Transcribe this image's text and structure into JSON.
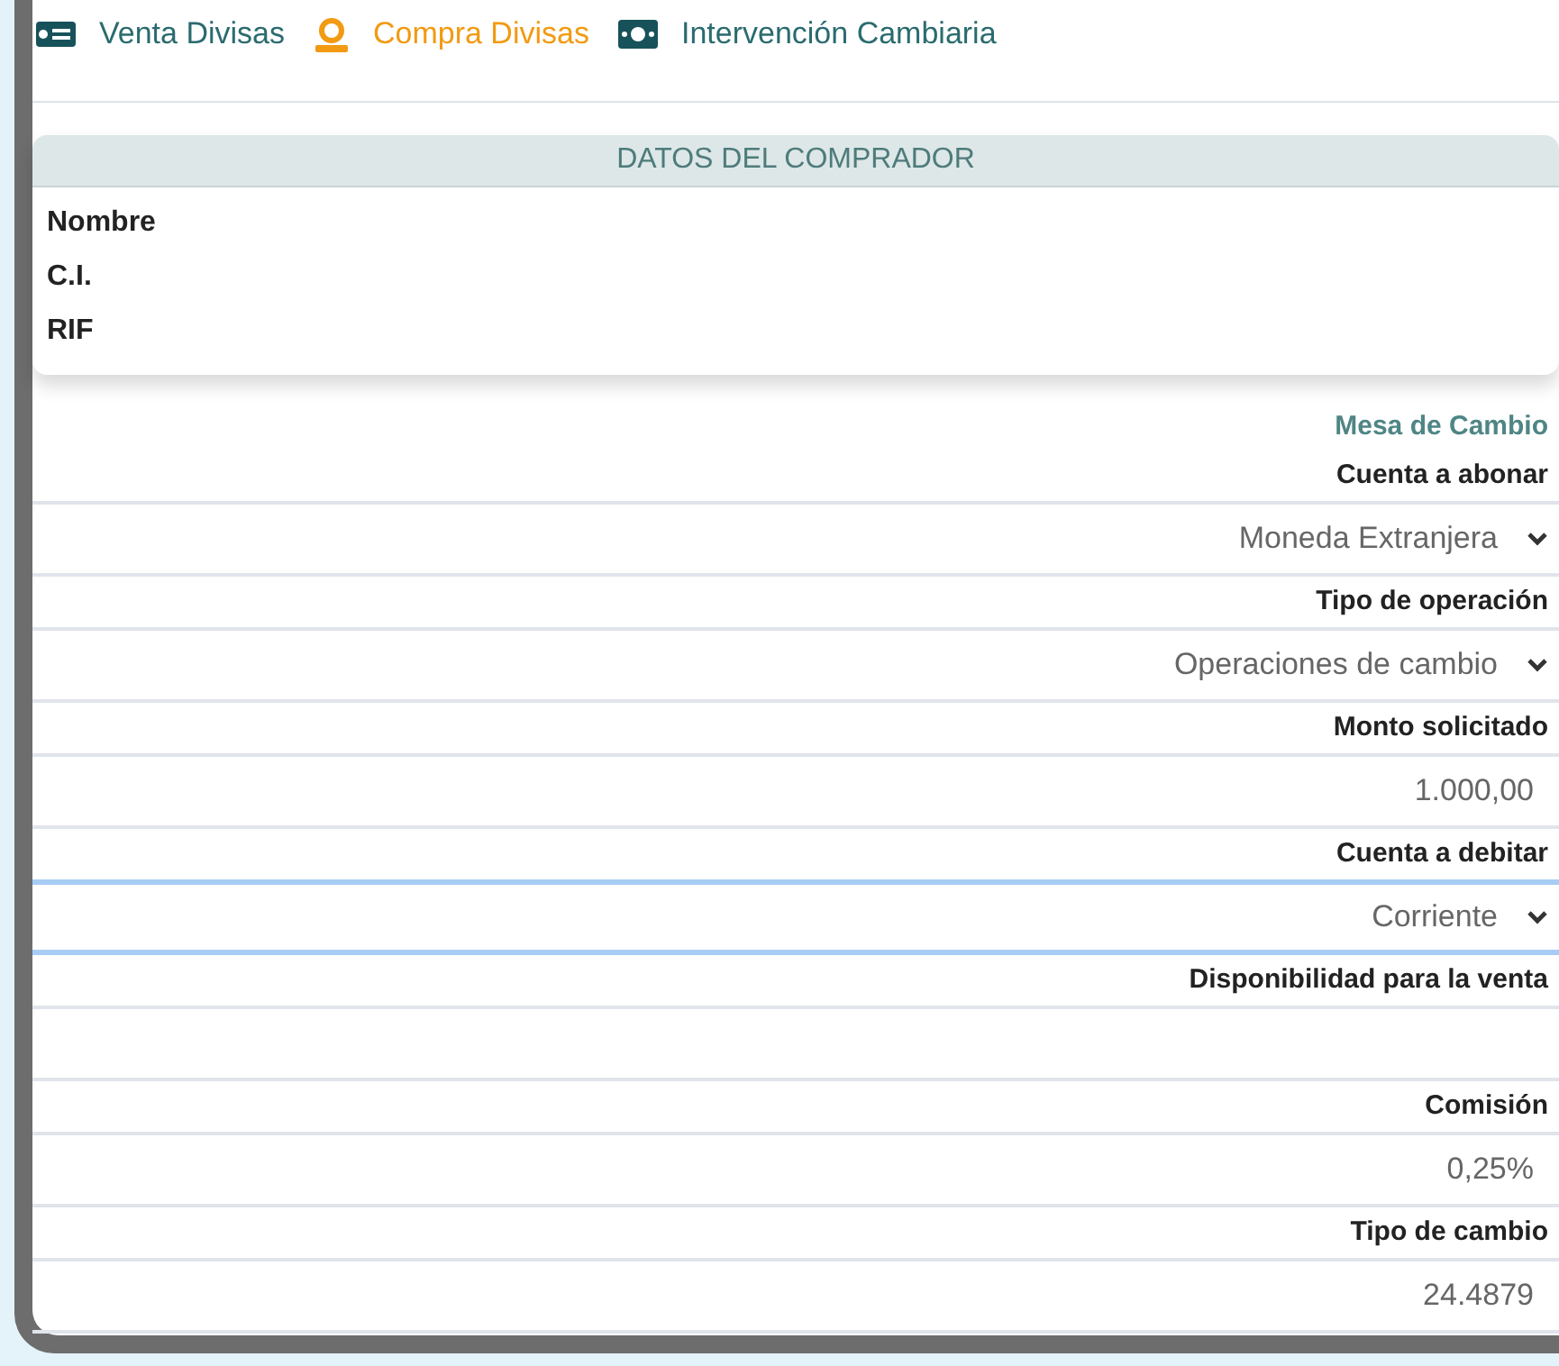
{
  "tabs": [
    {
      "label": "Venta Divisas",
      "selected": false
    },
    {
      "label": "Compra Divisas",
      "selected": true
    },
    {
      "label": "Intervención Cambiaria",
      "selected": false
    }
  ],
  "buyer_card": {
    "title": "DATOS DEL COMPRADOR",
    "fields": [
      "Nombre",
      "C.I.",
      "RIF"
    ]
  },
  "section_title": "Mesa de Cambio",
  "fields": [
    {
      "label": "Cuenta a abonar",
      "kind": "select",
      "value": "Moneda Extranjera",
      "focused": false
    },
    {
      "label": "Tipo de operación",
      "kind": "select",
      "value": "Operaciones de cambio",
      "focused": false
    },
    {
      "label": "Monto solicitado",
      "kind": "text",
      "value": "1.000,00",
      "focused": false
    },
    {
      "label": "Cuenta a debitar",
      "kind": "select",
      "value": "Corriente",
      "focused": true
    },
    {
      "label": "Disponibilidad para la venta",
      "kind": "text",
      "focused": false
    },
    {
      "label": "Comisión",
      "kind": "text",
      "value": "0,25%",
      "focused": false
    },
    {
      "label": "Tipo de cambio",
      "kind": "text",
      "value": "24.4879",
      "focused": false
    }
  ]
}
